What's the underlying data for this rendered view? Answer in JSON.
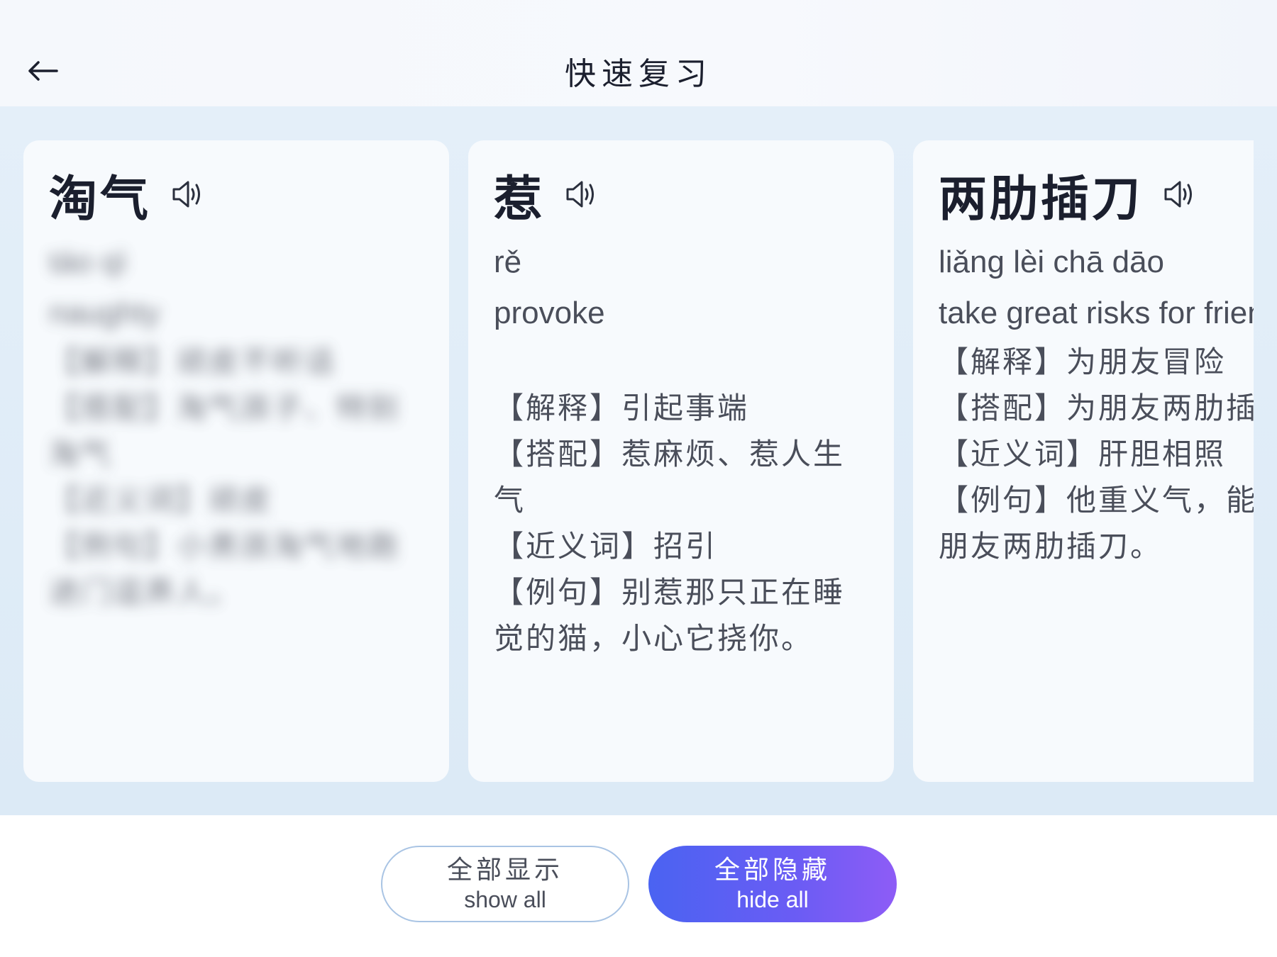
{
  "header": {
    "title": "快速复习",
    "back_icon": "arrow-left-icon"
  },
  "cards": [
    {
      "word": "淘气",
      "pinyin": "táo qì",
      "meaning": "naughty",
      "hidden": true,
      "details": [
        "【解释】顽皮不听话",
        "【搭配】淘气孩子、特别",
        "淘气",
        "【近义词】顽皮",
        "【例句】小男孩淘气地跑",
        "进门逗弄人。"
      ]
    },
    {
      "word": "惹",
      "pinyin": "rě",
      "meaning": "provoke",
      "hidden": false,
      "details": [
        "【解释】引起事端",
        "【搭配】惹麻烦、惹人生",
        "气",
        "【近义词】招引",
        "【例句】别惹那只正在睡",
        "觉的猫，小心它挠你。"
      ]
    },
    {
      "word": "两肋插刀",
      "pinyin": "liǎng lèi chā dāo",
      "meaning": "take great risks for friends",
      "hidden": false,
      "details": [
        "【解释】为朋友冒险",
        "【搭配】为朋友两肋插刀",
        "【近义词】肝胆相照",
        "【例句】他重义气，能为",
        "朋友两肋插刀。"
      ]
    }
  ],
  "footer": {
    "show_all_zh": "全部显示",
    "show_all_en": "show all",
    "hide_all_zh": "全部隐藏",
    "hide_all_en": "hide all"
  },
  "colors": {
    "background": "#dceaf6",
    "card": "#f7fafd",
    "hide_gradient_start": "#4a63f2",
    "hide_gradient_end": "#8e5cf6",
    "show_border": "#a9c4e4"
  },
  "icons": {
    "speaker": "speaker-icon"
  }
}
